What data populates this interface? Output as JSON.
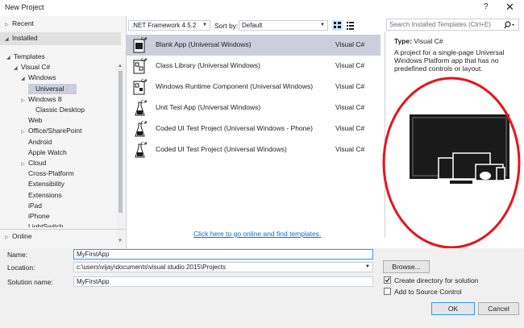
{
  "window": {
    "title": "New Project",
    "help": "?",
    "close": "✕"
  },
  "tree": {
    "recent": "Recent",
    "installed": "Installed",
    "items": [
      {
        "label": "Templates",
        "arrow": "◢"
      },
      {
        "label": "Visual C#",
        "arrow": "◢"
      },
      {
        "label": "Windows",
        "arrow": "◢"
      },
      {
        "label": "Universal",
        "arrow": ""
      },
      {
        "label": "Windows 8",
        "arrow": "▷"
      },
      {
        "label": "Classic Desktop",
        "arrow": ""
      },
      {
        "label": "Web",
        "arrow": ""
      },
      {
        "label": "Office/SharePoint",
        "arrow": "▷"
      },
      {
        "label": "Android",
        "arrow": ""
      },
      {
        "label": "Apple Watch",
        "arrow": ""
      },
      {
        "label": "Cloud",
        "arrow": "▷"
      },
      {
        "label": "Cross-Platform",
        "arrow": ""
      },
      {
        "label": "Extensibility",
        "arrow": ""
      },
      {
        "label": "Extensions",
        "arrow": ""
      },
      {
        "label": "iPad",
        "arrow": ""
      },
      {
        "label": "iPhone",
        "arrow": ""
      },
      {
        "label": "LightSwitch",
        "arrow": ""
      }
    ],
    "online": "Online"
  },
  "toolbar": {
    "framework": ".NET Framework 4.5.2",
    "sort_label": "Sort by:",
    "sort_value": "Default",
    "search_placeholder": "Search Installed Templates (Ctrl+E)"
  },
  "templates": [
    {
      "name": "Blank App (Universal Windows)",
      "lang": "Visual C#"
    },
    {
      "name": "Class Library (Universal Windows)",
      "lang": "Visual C#"
    },
    {
      "name": "Windows Runtime Component (Universal Windows)",
      "lang": "Visual C#"
    },
    {
      "name": "Unit Test App (Universal Windows)",
      "lang": "Visual C#"
    },
    {
      "name": "Coded UI Test Project (Universal Windows - Phone)",
      "lang": "Visual C#"
    },
    {
      "name": "Coded UI Test Project (Universal Windows)",
      "lang": "Visual C#"
    }
  ],
  "online_link": "Click here to go online and find templates.",
  "details": {
    "type_label": "Type:",
    "type_value": "Visual C#",
    "description": "A project for a single-page Universal Windows Platform app that has no predefined controls or layout."
  },
  "form": {
    "name_label": "Name:",
    "name_value": "MyFirstApp",
    "location_label": "Location:",
    "location_value": "c:\\users\\vijay\\documents\\visual studio 2015\\Projects",
    "solution_label": "Solution name:",
    "solution_value": "MyFirstApp",
    "browse": "Browse...",
    "create_dir": "Create directory for solution",
    "create_dir_checked": true,
    "add_source": "Add to Source Control",
    "add_source_checked": false,
    "ok": "OK",
    "cancel": "Cancel"
  },
  "colors": {
    "annotation": "#e8141c",
    "link": "#0e70c0",
    "selection": "#cccedb"
  }
}
